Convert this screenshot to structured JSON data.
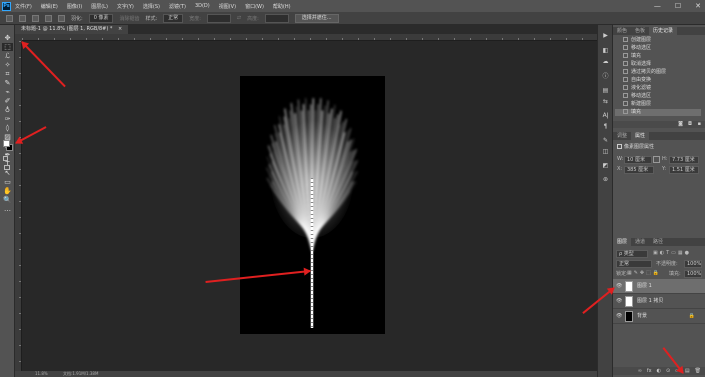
{
  "app": {
    "logo": "Ps"
  },
  "menubar": {
    "items": [
      "文件(F)",
      "编辑(E)",
      "图像(I)",
      "图层(L)",
      "文字(Y)",
      "选择(S)",
      "滤镜(T)",
      "3D(D)",
      "视图(V)",
      "窗口(W)",
      "帮助(H)"
    ],
    "min_label": "—",
    "max_label": "☐",
    "close_label": "✕"
  },
  "options": {
    "feather_label": "羽化:",
    "feather_value": "0 像素",
    "antialias_label": "消除锯齿",
    "style_label": "样式:",
    "style_value": "正常",
    "width_label": "宽度:",
    "height_label": "高度:",
    "select_mask_button": "选择并遮住..."
  },
  "document": {
    "tab_title": "未标题-1 @ 11.8% (图层 1, RGB/8#) *",
    "tab_close": "×",
    "zoom": "11.8%",
    "doc_info": "文档:1.91M/1.38M"
  },
  "panels": {
    "history_tabs": [
      "颜色",
      "色板",
      "历史记录"
    ],
    "history_items": [
      "创建图层",
      "移动选区",
      "填充",
      "取消选择",
      "通过拷贝的图层",
      "自由变换",
      "液化滤镜",
      "移动选区",
      "新建图层",
      "填充"
    ],
    "properties_tabs": [
      "调整",
      "属性"
    ],
    "properties_title": "像素图层属性",
    "props": {
      "w_label": "W:",
      "w_value": "10 厘米",
      "h_label": "H:",
      "h_value": "7.73 厘米",
      "x_label": "X:",
      "x_value": "385 厘米",
      "y_label": "Y:",
      "y_value": "1.51 厘米"
    },
    "layers_tabs": [
      "图层",
      "通道",
      "路径"
    ],
    "kind_label": "ρ 类型",
    "blend_mode": "正常",
    "opacity_label": "不透明度:",
    "opacity_value": "100%",
    "lock_label": "锁定:",
    "fill_label": "填充:",
    "fill_value": "100%",
    "layers": [
      {
        "name": "图层 1",
        "thumb": "white",
        "selected": true,
        "lock": ""
      },
      {
        "name": "图层 1 拷贝",
        "thumb": "white",
        "selected": false,
        "lock": ""
      },
      {
        "name": "背景",
        "thumb": "black",
        "selected": false,
        "lock": "🔒"
      }
    ],
    "bottom_icons": [
      "∞",
      "fx",
      "◐",
      "⊙",
      "▭",
      "▤",
      "🗑"
    ]
  },
  "tools": [
    "✥",
    "⬚",
    "ℒ",
    "✧",
    "⌗",
    "✎",
    "⌁",
    "✐",
    "♁",
    "✑",
    "◊",
    "▨",
    "◉",
    "✒",
    "T",
    "↖",
    "▭",
    "✋",
    "🔍",
    "…"
  ],
  "swatches": {
    "foreground": "#ffffff",
    "background": "#000000"
  },
  "strip_icons": [
    "▶",
    "◧",
    "☁",
    "ⓘ",
    "▤",
    "⇆",
    "Aǀ",
    "¶",
    "✎",
    "◫",
    "◩",
    "⊛"
  ],
  "colors": {
    "annotation": "#e02020",
    "panel": "#535353",
    "workspace": "#282828"
  }
}
